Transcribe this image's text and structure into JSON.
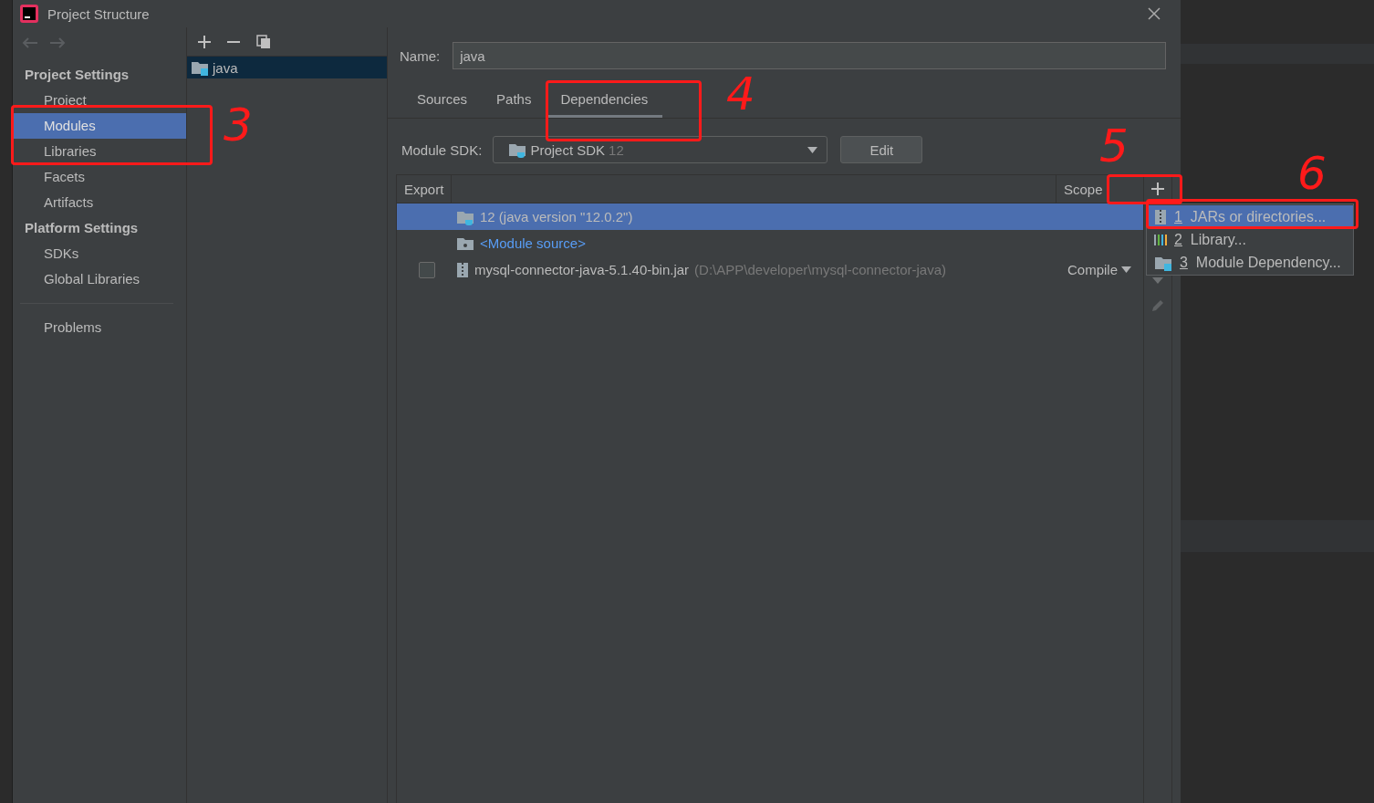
{
  "window": {
    "title": "Project Structure"
  },
  "sidebar": {
    "groups": [
      {
        "heading": "Project Settings",
        "items": [
          {
            "label": "Project",
            "selected": false
          },
          {
            "label": "Modules",
            "selected": true
          },
          {
            "label": "Libraries",
            "selected": false
          },
          {
            "label": "Facets",
            "selected": false
          },
          {
            "label": "Artifacts",
            "selected": false
          }
        ]
      },
      {
        "heading": "Platform Settings",
        "items": [
          {
            "label": "SDKs",
            "selected": false
          },
          {
            "label": "Global Libraries",
            "selected": false
          }
        ]
      }
    ],
    "footer_items": [
      {
        "label": "Problems",
        "selected": false
      }
    ]
  },
  "modules": [
    {
      "name": "java",
      "selected": true
    }
  ],
  "name_field": {
    "label": "Name:",
    "value": "java"
  },
  "tabs": [
    {
      "label": "Sources",
      "selected": false
    },
    {
      "label": "Paths",
      "selected": false
    },
    {
      "label": "Dependencies",
      "selected": true
    }
  ],
  "module_sdk": {
    "label": "Module SDK:",
    "value": "Project SDK",
    "version": "12",
    "button": "Edit"
  },
  "table": {
    "columns": [
      "Export",
      "Scope"
    ],
    "rows": [
      {
        "kind": "sdk",
        "name": "12 (java version \"12.0.2\")",
        "selected": true
      },
      {
        "kind": "source",
        "name": "<Module source>",
        "selected": false
      },
      {
        "kind": "library",
        "name": "mysql-connector-java-5.1.40-bin.jar",
        "path": "(D:\\APP\\developer\\mysql-connector-java)",
        "checked": false,
        "scope": "Compile",
        "selected": false
      }
    ]
  },
  "add_menu": [
    {
      "kind": "jar",
      "number": "1",
      "label": "JARs or directories...",
      "selected": true
    },
    {
      "kind": "library",
      "number": "2",
      "label": "Library...",
      "selected": false
    },
    {
      "kind": "module",
      "number": "3",
      "label": "Module Dependency...",
      "selected": false
    }
  ],
  "annotations": [
    {
      "label": "3"
    },
    {
      "label": "4"
    },
    {
      "label": "5"
    },
    {
      "label": "6"
    }
  ]
}
